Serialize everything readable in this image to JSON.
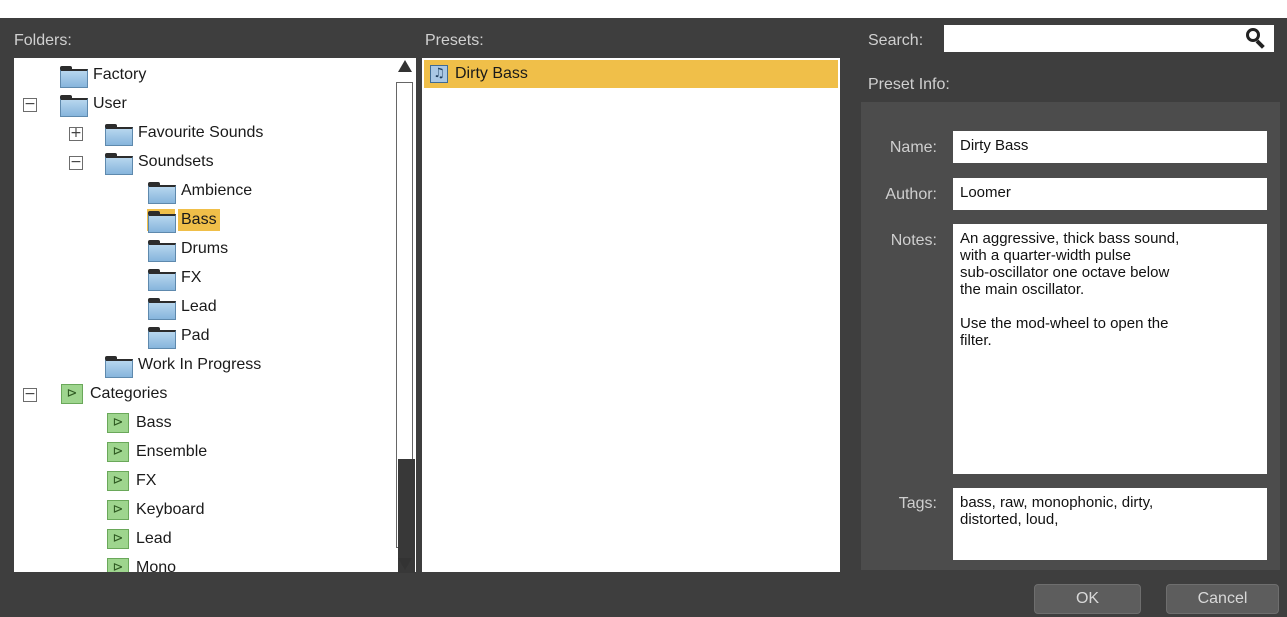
{
  "headers": {
    "folders": "Folders:",
    "presets": "Presets:",
    "search": "Search:",
    "preset_info": "Preset Info:"
  },
  "search": {
    "value": "",
    "placeholder": ""
  },
  "tree": [
    {
      "label": "Factory",
      "icon": "folder-icon"
    },
    {
      "label": "User",
      "icon": "folder-icon",
      "toggle": "minus"
    },
    {
      "label": "Favourite Sounds",
      "icon": "folder-icon",
      "toggle": "plus"
    },
    {
      "label": "Soundsets",
      "icon": "folder-icon",
      "toggle": "minus"
    },
    {
      "label": "Ambience",
      "icon": "folder-icon"
    },
    {
      "label": "Bass",
      "icon": "folder-icon",
      "selected": true
    },
    {
      "label": "Drums",
      "icon": "folder-icon"
    },
    {
      "label": "FX",
      "icon": "folder-icon"
    },
    {
      "label": "Lead",
      "icon": "folder-icon"
    },
    {
      "label": "Pad",
      "icon": "folder-icon"
    },
    {
      "label": "Work In Progress",
      "icon": "folder-icon"
    },
    {
      "label": "Categories",
      "icon": "category-icon",
      "toggle": "minus"
    },
    {
      "label": "Bass",
      "icon": "category-icon"
    },
    {
      "label": "Ensemble",
      "icon": "category-icon"
    },
    {
      "label": "FX",
      "icon": "category-icon"
    },
    {
      "label": "Keyboard",
      "icon": "category-icon"
    },
    {
      "label": "Lead",
      "icon": "category-icon"
    },
    {
      "label": "Mono",
      "icon": "category-icon"
    }
  ],
  "presets": [
    {
      "label": "Dirty Bass",
      "icon": "music-note-icon",
      "selected": true
    }
  ],
  "info": {
    "name_label": "Name:",
    "name": "Dirty Bass",
    "author_label": "Author:",
    "author": "Loomer",
    "notes_label": "Notes:",
    "notes": "An aggressive, thick bass sound,\nwith a quarter-width pulse\nsub-oscillator one octave below\nthe main oscillator.\n\nUse the mod-wheel to open the\nfilter.",
    "tags_label": "Tags:",
    "tags": "bass, raw, monophonic, dirty,\ndistorted, loud,"
  },
  "buttons": {
    "ok": "OK",
    "cancel": "Cancel"
  },
  "colors": {
    "background": "#3e3e3e",
    "selection": "#f0bf49",
    "info_panel": "#4c4c4c"
  }
}
